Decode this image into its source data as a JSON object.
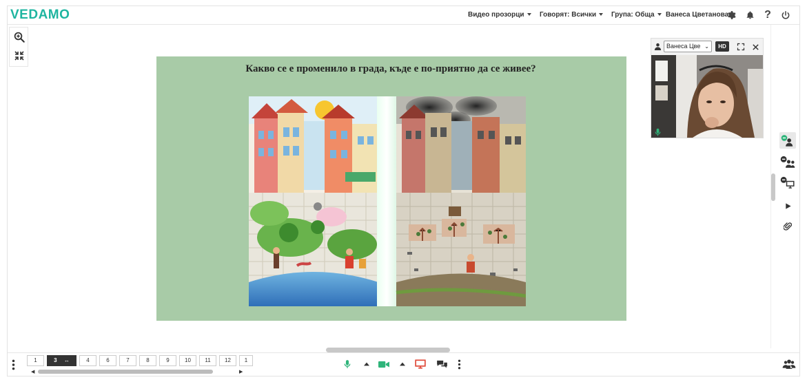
{
  "app": {
    "logo": "VEDAMO"
  },
  "topbar": {
    "video_windows_label": "Видео прозорци",
    "speaking_label": "Говорят: Всички",
    "group_label": "Група: Обща",
    "user_name": "Ванеса Цветанова"
  },
  "slide": {
    "title": "Какво се е променило в града, къде е по-приятно да се живее?"
  },
  "video": {
    "selected_user": "Ванеса Цве",
    "quality_badge": "HD"
  },
  "pagination": {
    "pages": [
      "1",
      "3",
      "4",
      "6",
      "7",
      "8",
      "9",
      "10",
      "11",
      "12",
      "1"
    ],
    "current_index": 1,
    "current_page": "3",
    "swap_glyph": "↔"
  },
  "colors": {
    "brand": "#1fb5a0",
    "mic_active": "#2fb47a",
    "camera_active": "#2fb47a",
    "screen_share": "#e04a3a",
    "slide_background": "#a8cba7"
  },
  "icons": {
    "toolbar": [
      "zoom-in-icon",
      "collapse-icon"
    ],
    "topbar": [
      "gear-icon",
      "bell-icon",
      "help-icon",
      "power-icon"
    ],
    "video": [
      "person-icon",
      "fullscreen-icon",
      "close-icon",
      "microphone-icon"
    ],
    "sidebar": [
      "participant-icon",
      "participants-group-icon",
      "screen-share-user-icon",
      "play-icon",
      "attachment-icon"
    ],
    "bottom": [
      "more-options-icon",
      "microphone-icon",
      "camera-icon",
      "screen-share-icon",
      "chat-icon",
      "more-options-icon",
      "people-icon"
    ]
  }
}
